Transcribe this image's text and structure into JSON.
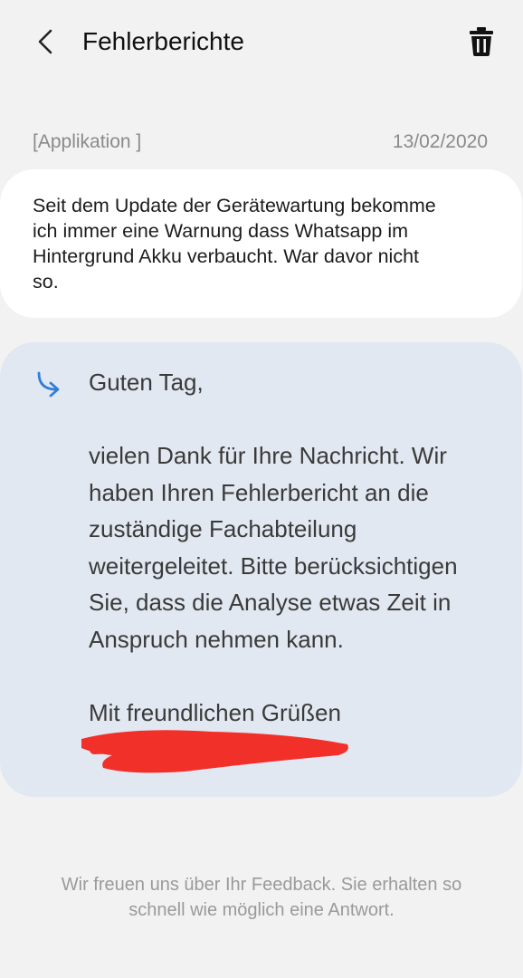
{
  "header": {
    "title": "Fehlerberichte"
  },
  "report": {
    "category": "[Applikation  ]",
    "date": "13/02/2020",
    "message": "Seit dem Update der Gerätewartung bekomme\nich immer eine Warnung dass Whatsapp im\nHintergrund Akku verbaucht. War davor nicht\nso."
  },
  "reply": {
    "text": "Guten Tag,\n\nvielen Dank für Ihre Nachricht. Wir\nhaben Ihren Fehlerbericht an die\nzuständige Fachabteilung\nweitergeleitet. Bitte berücksichtigen\nSie, dass die Analyse etwas Zeit in\nAnspruch nehmen kann.\n\nMit freundlichen Grüßen"
  },
  "footer": {
    "text": "Wir freuen uns über Ihr Feedback. Sie erhalten so\nschnell wie möglich eine Antwort."
  },
  "colors": {
    "background": "#f2f2f2",
    "reply_card": "#e2e8f1",
    "reply_icon": "#2f7fd8",
    "redaction": "#f2302a"
  },
  "icons": {
    "back": "back-arrow-icon",
    "delete": "trash-icon",
    "reply": "reply-arrow-icon"
  }
}
